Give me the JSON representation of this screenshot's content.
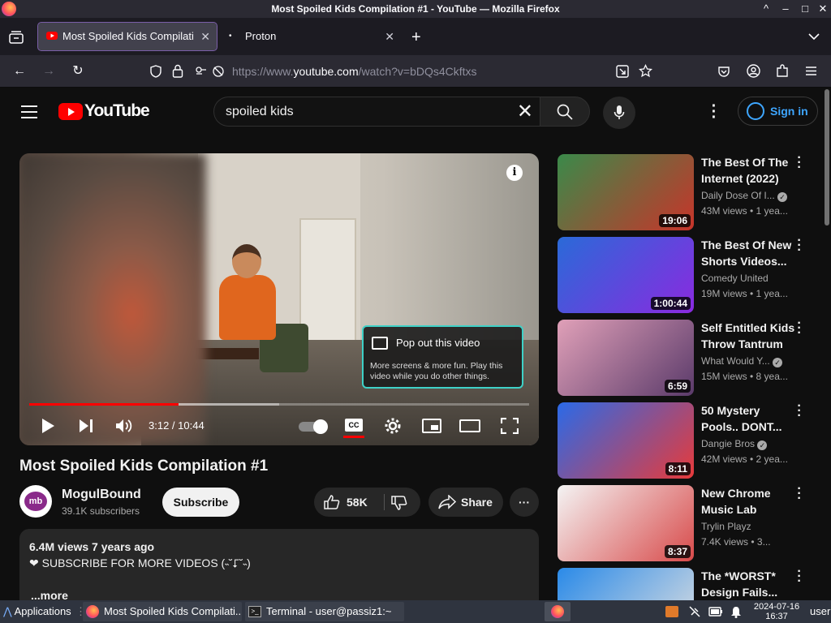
{
  "window": {
    "title": "Most Spoiled Kids Compilation #1 - YouTube — Mozilla Firefox",
    "controls": [
      "^",
      "–",
      "□",
      "✕"
    ]
  },
  "tabs": [
    {
      "label": "Most Spoiled Kids Compilati",
      "close": "✕",
      "active": true
    },
    {
      "label": "Proton",
      "close": "✕",
      "active": false
    }
  ],
  "newtab": "+",
  "address": {
    "prefix": "https://www.",
    "domain": "youtube.com",
    "path": "/watch?v=bDQs4Ckftxs"
  },
  "youtube": {
    "logo_text": "YouTube",
    "search_value": "spoiled kids",
    "sign_in": "Sign in"
  },
  "player": {
    "popout_title": "Pop out this video",
    "popout_desc": "More screens & more fun. Play this video while you do other things.",
    "time": "3:12 / 10:44",
    "progress": 0.298,
    "cc_label": "CC",
    "info": "i"
  },
  "video": {
    "title": "Most Spoiled Kids Compilation #1",
    "channel": "MogulBound",
    "subscribers": "39.1K subscribers",
    "subscribe": "Subscribe",
    "likes": "58K",
    "share": "Share",
    "meta": "6.4M views  7 years ago",
    "desc_line": "❤ SUBSCRIBE FOR MORE VIDEOS (˵˘⮦˘˵)",
    "more": "...more"
  },
  "recommendations": [
    {
      "title": "The Best Of The Internet (2022)",
      "channel": "Daily Dose Of I...",
      "verified": true,
      "views": "43M views  •  1 yea...",
      "duration": "19:06",
      "colors": [
        "#3a8a4a",
        "#c8342a"
      ]
    },
    {
      "title": "The Best Of New Shorts Videos...",
      "channel": "Comedy United",
      "verified": false,
      "views": "19M views  •  1 yea...",
      "duration": "1:00:44",
      "colors": [
        "#2a6ad8",
        "#8a2ae0"
      ]
    },
    {
      "title": "Self Entitled Kids Throw Tantrum |...",
      "channel": "What Would Y...",
      "verified": true,
      "views": "15M views  •  8 yea...",
      "duration": "6:59",
      "colors": [
        "#e0a0b8",
        "#5a3a6a"
      ]
    },
    {
      "title": "50 Mystery Pools.. DONT...",
      "channel": "Dangie Bros",
      "verified": true,
      "views": "42M views  •  2 yea...",
      "duration": "8:11",
      "colors": [
        "#2a6ae8",
        "#e83a3a"
      ]
    },
    {
      "title": "New Chrome Music Lab Song...",
      "channel": "Trylin Playz",
      "verified": false,
      "views": "7.4K views  •  3...",
      "duration": "8:37",
      "colors": [
        "#f4f4f4",
        "#d84a4a"
      ]
    },
    {
      "title": "The *WORST* Design Fails...",
      "channel": "",
      "verified": false,
      "views": "",
      "duration": "",
      "colors": [
        "#2a8ae8",
        "#e0e0e0"
      ]
    }
  ],
  "taskbar": {
    "apps": "Applications",
    "items": [
      "Most Spoiled Kids Compilati...",
      "Terminal - user@passiz1:~"
    ],
    "date": "2024-07-16",
    "time": "16:37",
    "user": "user"
  }
}
